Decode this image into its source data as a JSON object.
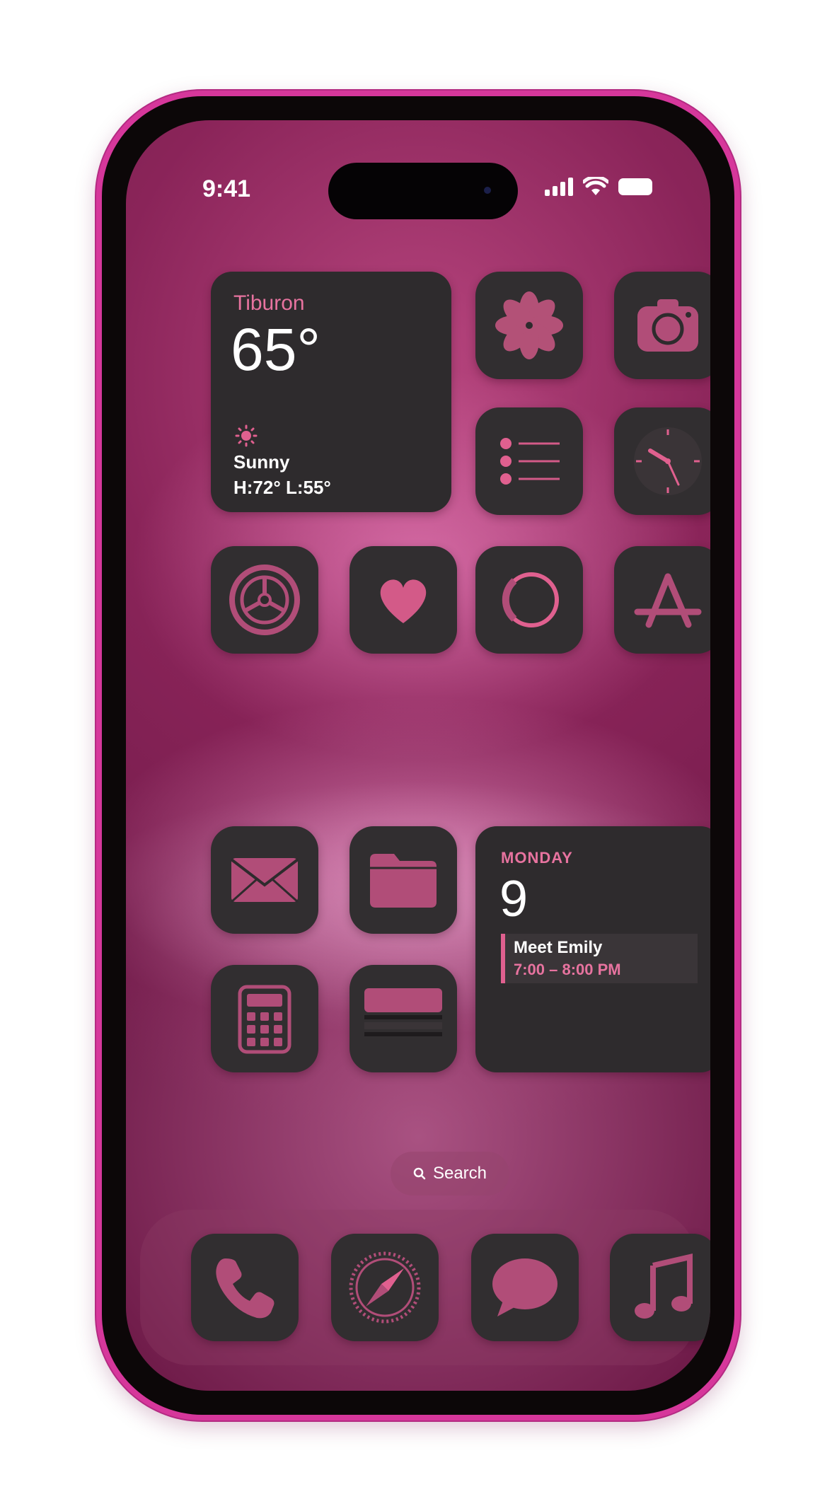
{
  "status_bar": {
    "time": "9:41"
  },
  "weather_widget": {
    "city": "Tiburon",
    "temperature": "65°",
    "condition": "Sunny",
    "range": "H:72° L:55°"
  },
  "calendar_widget": {
    "day": "MONDAY",
    "date": "9",
    "event_title": "Meet Emily",
    "event_time": "7:00 – 8:00 PM"
  },
  "search": {
    "label": "Search"
  },
  "apps": {
    "row1": [
      "Photos",
      "Camera"
    ],
    "row2": [
      "Reminders",
      "Clock"
    ],
    "row3": [
      "Settings",
      "Health",
      "Fitness",
      "App Store"
    ],
    "row4": [
      "Mail",
      "Files"
    ],
    "row5": [
      "Calculator",
      "Wallet"
    ],
    "dock": [
      "Phone",
      "Safari",
      "Messages",
      "Music"
    ]
  },
  "colors": {
    "accent": "#e0608f",
    "tile": "#312e30",
    "frame": "#d6379b"
  }
}
